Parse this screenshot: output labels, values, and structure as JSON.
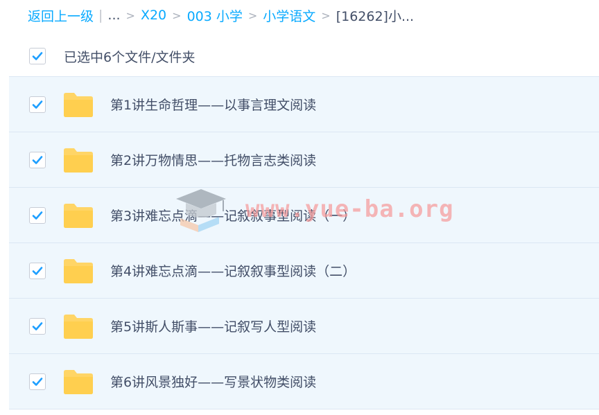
{
  "breadcrumb": {
    "back": "返回上一级",
    "pipe": "|",
    "ellipsis": "...",
    "sep": ">",
    "crumbs": [
      "X20",
      "003 小学",
      "小学语文"
    ],
    "current": "[16262]小..."
  },
  "selection": {
    "label": "已选中6个文件/文件夹",
    "all_checked": true
  },
  "files": [
    {
      "name": "第1讲生命哲理——以事言理文阅读",
      "checked": true,
      "icon": "folder-icon"
    },
    {
      "name": "第2讲万物情思——托物言志类阅读",
      "checked": true,
      "icon": "folder-icon"
    },
    {
      "name": "第3讲难忘点滴——记叙叙事型阅读（一）",
      "checked": true,
      "icon": "folder-icon"
    },
    {
      "name": "第4讲难忘点滴——记叙叙事型阅读（二）",
      "checked": true,
      "icon": "folder-icon"
    },
    {
      "name": "第5讲斯人斯事——记叙写人型阅读",
      "checked": true,
      "icon": "folder-icon"
    },
    {
      "name": "第6讲风景独好——写景状物类阅读",
      "checked": true,
      "icon": "folder-icon"
    }
  ],
  "watermark": {
    "text": "www.yue-ba.org",
    "icon": "graduation-cap-icon"
  },
  "colors": {
    "link": "#09aaff",
    "check": "#1e9fff",
    "folder": "#ffd566",
    "row_selected_bg": "#eff7fd",
    "text": "#424e67"
  }
}
